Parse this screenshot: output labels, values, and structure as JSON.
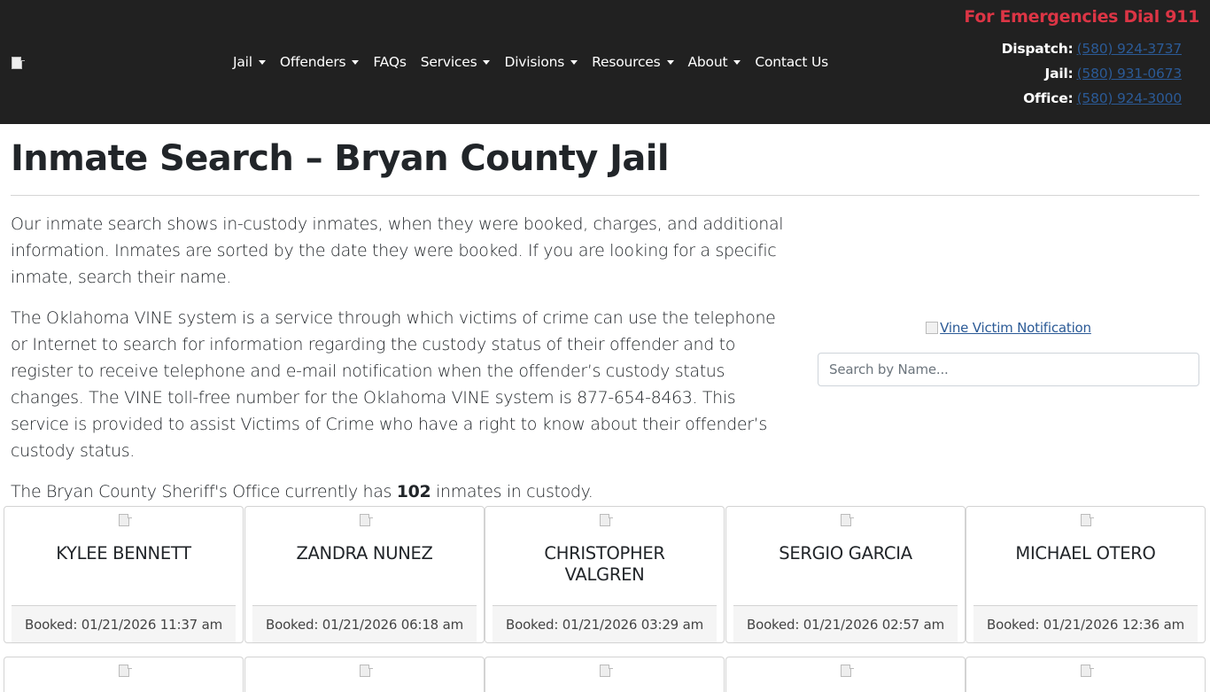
{
  "header": {
    "logo_alt": "",
    "nav": [
      {
        "label": "Jail",
        "dropdown": true
      },
      {
        "label": "Offenders",
        "dropdown": true
      },
      {
        "label": "FAQs",
        "dropdown": false
      },
      {
        "label": "Services",
        "dropdown": true
      },
      {
        "label": "Divisions",
        "dropdown": true
      },
      {
        "label": "Resources",
        "dropdown": true
      },
      {
        "label": "About",
        "dropdown": true
      },
      {
        "label": "Contact Us",
        "dropdown": false
      }
    ],
    "emergency": "For Emergencies Dial 911",
    "contacts": [
      {
        "label": "Dispatch:",
        "phone": "(580) 924-3737"
      },
      {
        "label": "Jail:",
        "phone": "(580) 931-0673"
      },
      {
        "label": "Office:",
        "phone": "(580) 924-3000"
      }
    ]
  },
  "main": {
    "title": "Inmate Search – Bryan County Jail",
    "paragraphs": [
      "Our inmate search shows in-custody inmates, when they were booked, charges, and additional information. Inmates are sorted by the date they were booked. If you are looking for a specific inmate, search their name.",
      "The Oklahoma VINE system is a service through which victims of crime can use the telephone or Internet to search for information regarding the custody status of their offender and to register to receive telephone and e-mail notification when the offender’s custody status changes. The VINE toll-free number for the Oklahoma VINE system is 877-654-8463. This service is provided to assist Victims of Crime who have a right to know about their offender’s custody status."
    ],
    "count_prefix": "The Bryan County Sheriff's Office currently has ",
    "count": "102",
    "count_suffix": " inmates in custody."
  },
  "sidebar": {
    "vine_link": "Vine Victim Notification",
    "search_placeholder": "Search by Name..."
  },
  "inmates": [
    {
      "name": "KYLEE BENNETT",
      "booked": "Booked: 01/21/2026 11:37 am"
    },
    {
      "name": "ZANDRA NUNEZ",
      "booked": "Booked: 01/21/2026 06:18 am"
    },
    {
      "name": "CHRISTOPHER VALGREN",
      "booked": "Booked: 01/21/2026 03:29 am"
    },
    {
      "name": "SERGIO GARCIA",
      "booked": "Booked: 01/21/2026 02:57 am"
    },
    {
      "name": "MICHAEL OTERO",
      "booked": "Booked: 01/21/2026 12:36 am"
    }
  ],
  "colors": {
    "header_bg": "#212121",
    "emergency": "#dc3545",
    "link": "#2b5a96"
  }
}
